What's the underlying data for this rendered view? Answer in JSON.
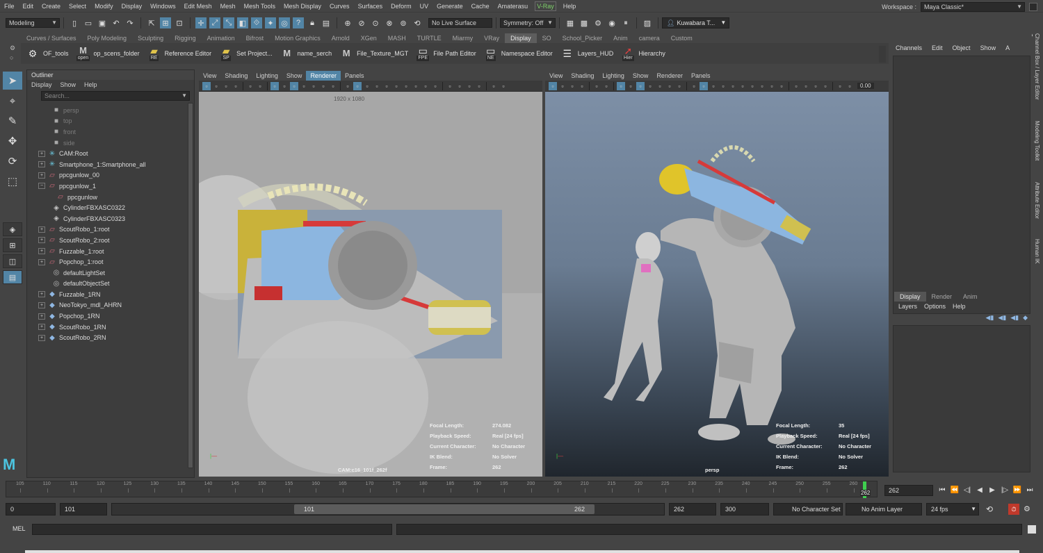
{
  "menubar": {
    "items": [
      "File",
      "Edit",
      "Create",
      "Select",
      "Modify",
      "Display",
      "Windows",
      "Edit Mesh",
      "Mesh",
      "Mesh Tools",
      "Mesh Display",
      "Curves",
      "Surfaces",
      "Deform",
      "UV",
      "Generate",
      "Cache",
      "Amaterasu"
    ],
    "vray": "V-Ray",
    "help": "Help",
    "workspace_label": "Workspace :",
    "workspace_value": "Maya Classic*"
  },
  "statusline": {
    "mode": "Modeling",
    "live_surface": "No Live Surface",
    "symmetry": "Symmetry: Off",
    "user": "Kuwabara T..."
  },
  "shelf": {
    "tabs": [
      "Curves / Surfaces",
      "Poly Modeling",
      "Sculpting",
      "Rigging",
      "Animation",
      "Bifrost",
      "Motion Graphics",
      "Arnold",
      "XGen",
      "MASH",
      "TURTLE",
      "Miarmy",
      "VRay",
      "Display",
      "SO",
      "School_Picker",
      "Anim",
      "camera",
      "Custom"
    ],
    "active_tab": "Display",
    "items": [
      {
        "label": "OF_tools",
        "icon": "tools-icon",
        "sub": ""
      },
      {
        "label": "op_scens_folder",
        "icon": "maya-m-icon",
        "sub": "open"
      },
      {
        "label": "Reference Editor",
        "icon": "folder-icon",
        "sub": "RE"
      },
      {
        "label": "Set Project...",
        "icon": "folder-icon",
        "sub": "SP"
      },
      {
        "label": "name_serch",
        "icon": "maya-m-icon",
        "sub": ""
      },
      {
        "label": "File_Texture_MGT",
        "icon": "maya-m-icon",
        "sub": ""
      },
      {
        "label": "File Path Editor",
        "icon": "window-icon",
        "sub": "FPE"
      },
      {
        "label": "Namespace Editor",
        "icon": "window-icon",
        "sub": "NE"
      },
      {
        "label": "Layers_HUD",
        "icon": "layers-icon",
        "sub": ""
      },
      {
        "label": "Hierarchy",
        "icon": "cursor-icon",
        "sub": "Hier"
      }
    ]
  },
  "outliner": {
    "title": "Outliner",
    "menu": [
      "Display",
      "Show",
      "Help"
    ],
    "search_placeholder": "Search...",
    "nodes": [
      {
        "label": "persp",
        "icon": "camera-icon",
        "expand": "",
        "indent": 1,
        "dim": true
      },
      {
        "label": "top",
        "icon": "camera-icon",
        "expand": "",
        "indent": 1,
        "dim": true
      },
      {
        "label": "front",
        "icon": "camera-icon",
        "expand": "",
        "indent": 1,
        "dim": true
      },
      {
        "label": "side",
        "icon": "camera-icon",
        "expand": "",
        "indent": 1,
        "dim": true
      },
      {
        "label": "CAM:Root",
        "icon": "joint-icon",
        "expand": "+",
        "indent": 0,
        "dim": false
      },
      {
        "label": "Smartphone_1:Smartphone_all",
        "icon": "joint-icon",
        "expand": "+",
        "indent": 0,
        "dim": false
      },
      {
        "label": "ppcgunlow_00",
        "icon": "mesh-icon",
        "expand": "+",
        "indent": 0,
        "dim": false
      },
      {
        "label": "ppcgunlow_1",
        "icon": "mesh-icon",
        "expand": "-",
        "indent": 0,
        "dim": false
      },
      {
        "label": "ppcgunlow",
        "icon": "mesh-icon",
        "expand": "",
        "indent": 2,
        "dim": false
      },
      {
        "label": "CylinderFBXASC0322",
        "icon": "group-icon",
        "expand": "",
        "indent": 1,
        "dim": false
      },
      {
        "label": "CylinderFBXASC0323",
        "icon": "group-icon",
        "expand": "",
        "indent": 1,
        "dim": false
      },
      {
        "label": "ScoutRobo_1:root",
        "icon": "mesh-icon",
        "expand": "+",
        "indent": 0,
        "dim": false
      },
      {
        "label": "ScoutRobo_2:root",
        "icon": "mesh-icon",
        "expand": "+",
        "indent": 0,
        "dim": false
      },
      {
        "label": "Fuzzable_1:root",
        "icon": "mesh-icon",
        "expand": "+",
        "indent": 0,
        "dim": false
      },
      {
        "label": "Popchop_1:root",
        "icon": "mesh-icon",
        "expand": "+",
        "indent": 0,
        "dim": false
      },
      {
        "label": "defaultLightSet",
        "icon": "set-icon",
        "expand": "",
        "indent": 1,
        "dim": false
      },
      {
        "label": "defaultObjectSet",
        "icon": "set-icon",
        "expand": "",
        "indent": 1,
        "dim": false
      },
      {
        "label": "Fuzzable_1RN",
        "icon": "reference-icon",
        "expand": "+",
        "indent": 0,
        "dim": false
      },
      {
        "label": "NeoTokyo_mdl_AHRN",
        "icon": "reference-icon",
        "expand": "+",
        "indent": 0,
        "dim": false
      },
      {
        "label": "Popchop_1RN",
        "icon": "reference-icon",
        "expand": "+",
        "indent": 0,
        "dim": false
      },
      {
        "label": "ScoutRobo_1RN",
        "icon": "reference-icon",
        "expand": "+",
        "indent": 0,
        "dim": false
      },
      {
        "label": "ScoutRobo_2RN",
        "icon": "reference-icon",
        "expand": "+",
        "indent": 0,
        "dim": false
      }
    ]
  },
  "viewport1": {
    "menu": [
      "View",
      "Shading",
      "Lighting",
      "Show",
      "Renderer",
      "Panels"
    ],
    "highlight": "Renderer",
    "resolution": "1920 x 1080",
    "camera": "CAM:c16_101f_262f",
    "hud": [
      [
        "Focal Length:",
        "274.082"
      ],
      [
        "Playback Speed:",
        "Real [24 fps]"
      ],
      [
        "Current Character:",
        "No Character"
      ],
      [
        "IK Blend:",
        "No Solver"
      ],
      [
        "Frame:",
        "262"
      ]
    ]
  },
  "viewport2": {
    "menu": [
      "View",
      "Shading",
      "Lighting",
      "Show",
      "Renderer",
      "Panels"
    ],
    "exposure": "0.00",
    "camera": "persp",
    "hud": [
      [
        "Focal Length:",
        "35"
      ],
      [
        "Playback Speed:",
        "Real [24 fps]"
      ],
      [
        "Current Character:",
        "No Character"
      ],
      [
        "IK Blend:",
        "No Solver"
      ],
      [
        "Frame:",
        "262"
      ]
    ]
  },
  "channelbox": {
    "menu": [
      "Channels",
      "Edit",
      "Object",
      "Show",
      "A"
    ],
    "layer_tabs": [
      "Display",
      "Render",
      "Anim"
    ],
    "layer_menu": [
      "Layers",
      "Options",
      "Help"
    ],
    "side_tabs": [
      "Channel Box / Layer Editor",
      "Modeling Toolkit",
      "Attribute Editor",
      "Human IK"
    ]
  },
  "timeline": {
    "ticks": [
      "105",
      "110",
      "115",
      "120",
      "125",
      "130",
      "135",
      "140",
      "145",
      "150",
      "155",
      "160",
      "165",
      "170",
      "175",
      "180",
      "185",
      "190",
      "195",
      "200",
      "205",
      "210",
      "215",
      "220",
      "225",
      "230",
      "235",
      "240",
      "245",
      "250",
      "255",
      "260"
    ],
    "tick_start": 105,
    "tick_end": 262,
    "current": "262",
    "current_field": "262"
  },
  "range": {
    "start": "0",
    "inner_start": "101",
    "thumb_left": "101",
    "thumb_right": "262",
    "inner_end": "262",
    "end": "300",
    "character_set": "No Character Set",
    "anim_layer": "No Anim Layer",
    "fps": "24 fps"
  },
  "mel": {
    "label": "MEL"
  }
}
